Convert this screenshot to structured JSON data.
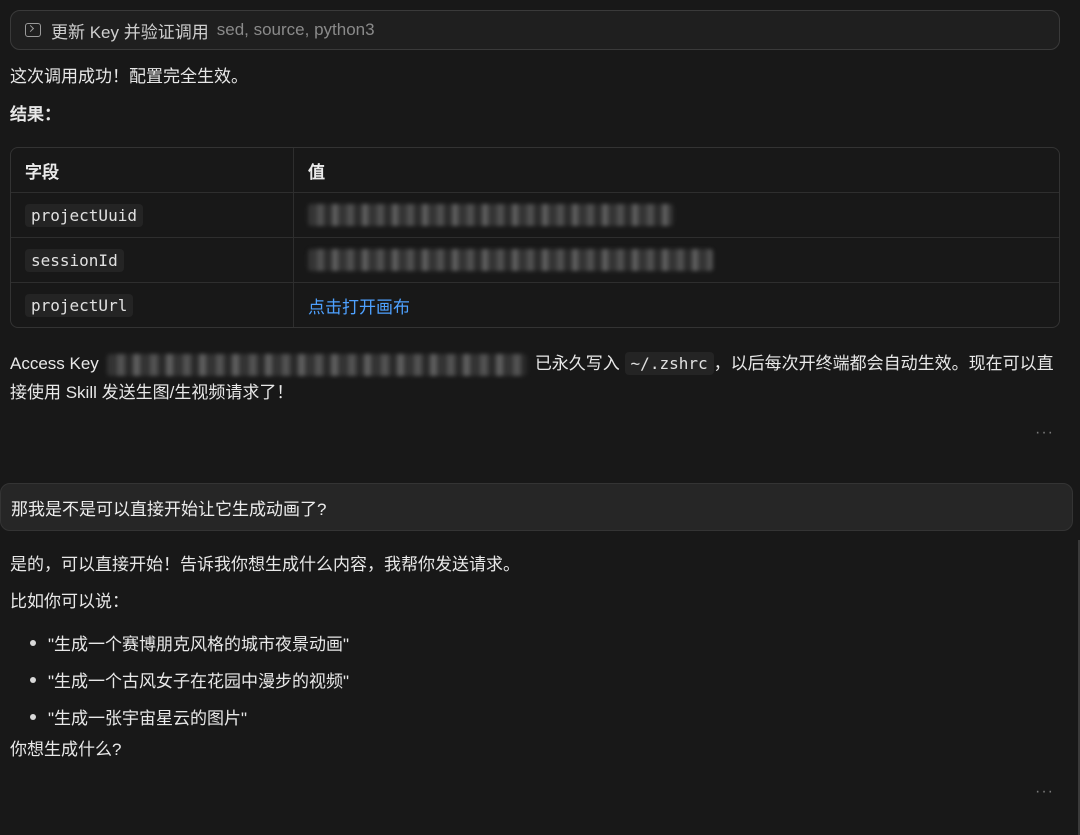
{
  "tool_call": {
    "title": "更新 Key 并验证调用",
    "commands": "sed, source, python3"
  },
  "assistant_1": {
    "line1": "这次调用成功！配置完全生效。",
    "result_label": "结果：",
    "table": {
      "headers": [
        "字段",
        "值"
      ],
      "rows": [
        {
          "field": "projectUuid",
          "value": ""
        },
        {
          "field": "sessionId",
          "value": ""
        },
        {
          "field": "projectUrl",
          "value": "点击打开画布"
        }
      ]
    },
    "access_prefix": "Access Key",
    "access_mid": "已永久写入",
    "access_path": "~/.zshrc",
    "access_suffix": "，以后每次开终端都会自动生效。现在可以直接使用 Skill 发送生图/生视频请求了！",
    "more": "···"
  },
  "user_message": "那我是不是可以直接开始让它生成动画了?",
  "assistant_2": {
    "line1": "是的，可以直接开始！告诉我你想生成什么内容，我帮你发送请求。",
    "line2": "比如你可以说：",
    "examples": [
      "\"生成一个赛博朋克风格的城市夜景动画\"",
      "\"生成一个古风女子在花园中漫步的视频\"",
      "\"生成一张宇宙星云的图片\""
    ],
    "closing": "你想生成什么?",
    "more": "···"
  }
}
